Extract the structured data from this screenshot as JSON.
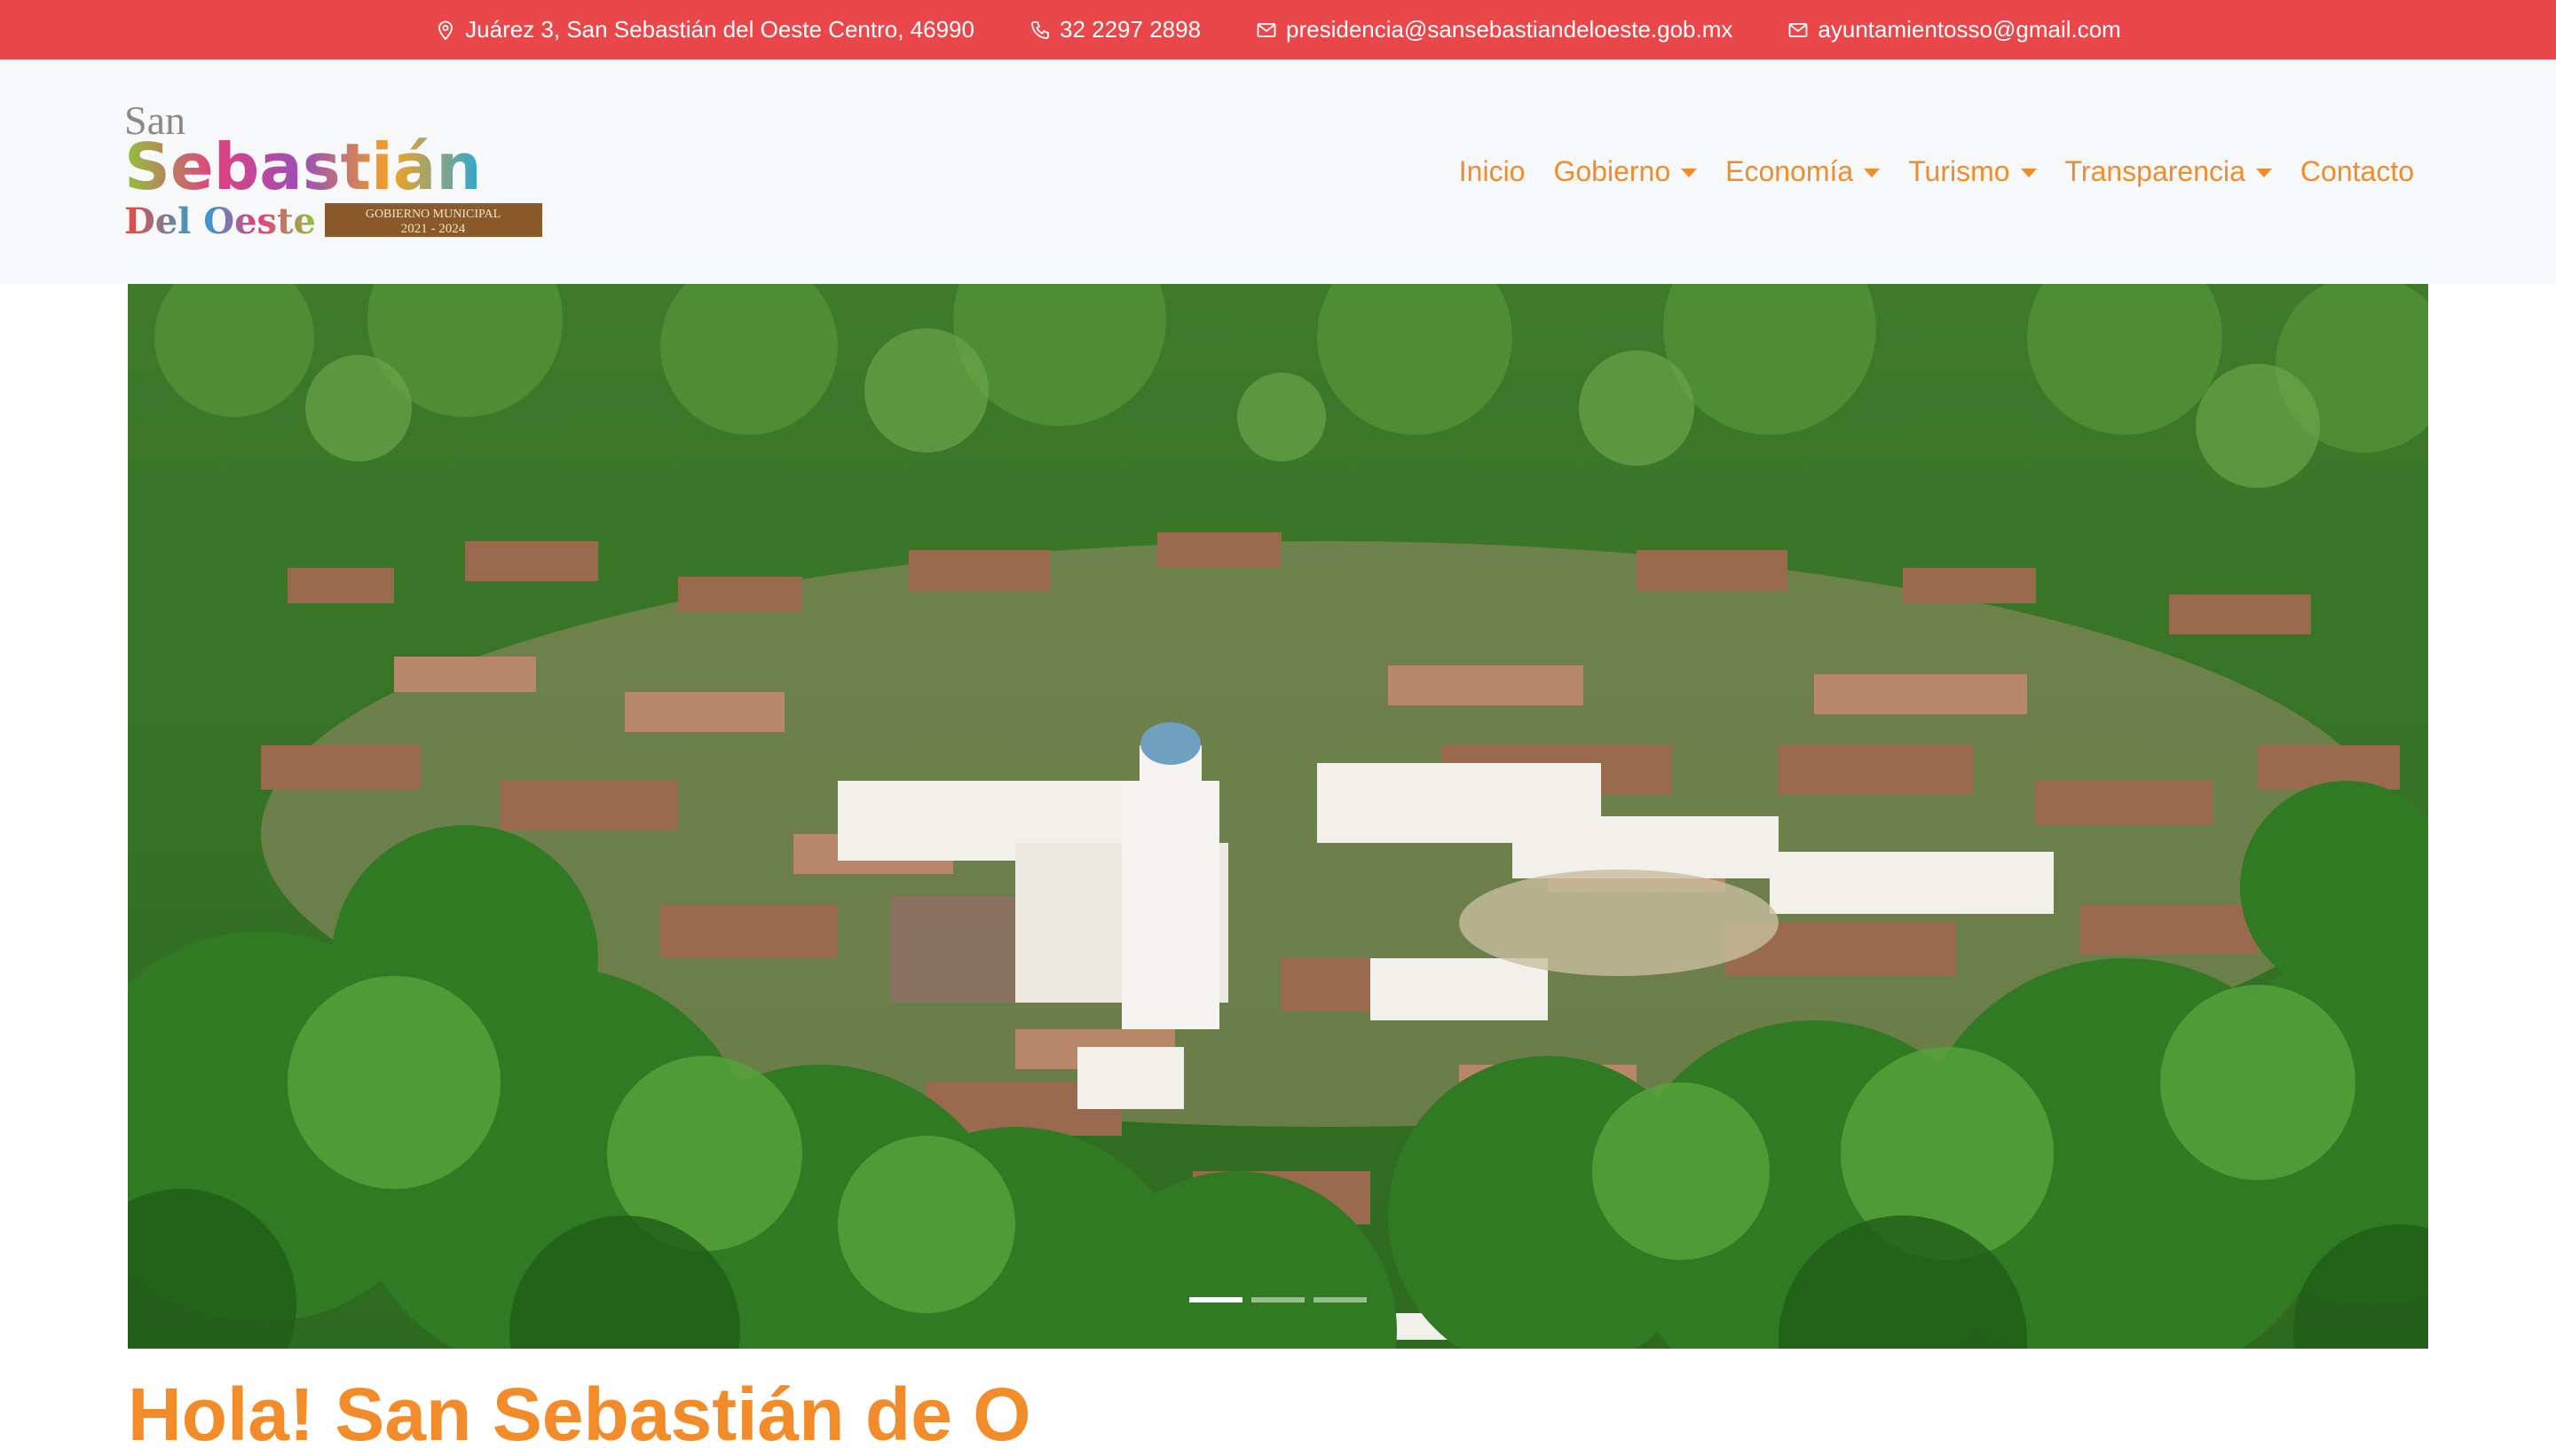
{
  "topbar": {
    "address": "Juárez 3, San Sebastián del Oeste Centro, 46990",
    "phone": "32 2297 2898",
    "email_primary": "presidencia@sansebastiandeloeste.gob.mx",
    "email_secondary": "ayuntamientosso@gmail.com",
    "icons": [
      "location-pin-icon",
      "phone-icon",
      "envelope-icon",
      "envelope-icon"
    ]
  },
  "logo": {
    "line1": "San",
    "line2": "Sebastián",
    "line3": "Del Oeste",
    "badge_line1": "GOBIERNO MUNICIPAL",
    "badge_line2": "2021 - 2024"
  },
  "nav": {
    "items": [
      {
        "label": "Inicio",
        "dropdown": false
      },
      {
        "label": "Gobierno",
        "dropdown": true
      },
      {
        "label": "Economía",
        "dropdown": true
      },
      {
        "label": "Turismo",
        "dropdown": true
      },
      {
        "label": "Transparencia",
        "dropdown": true
      },
      {
        "label": "Contacto",
        "dropdown": false
      }
    ]
  },
  "carousel": {
    "slide_count": 3,
    "active_index": 0
  },
  "section": {
    "title": "Hola! San Sebastián de O"
  },
  "colors": {
    "topbar_bg": "#e9474a",
    "accent": "#f28c2b",
    "header_bg": "#f7f8f9"
  }
}
